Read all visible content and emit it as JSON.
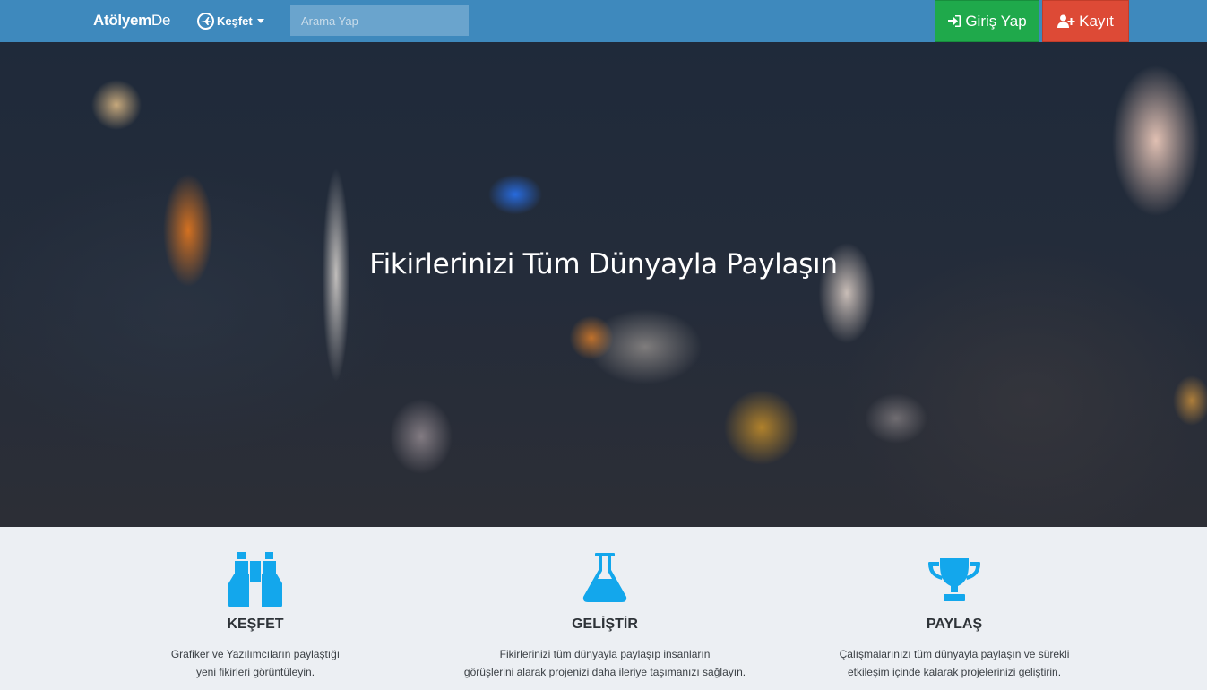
{
  "navbar": {
    "brand_bold": "Atölyem",
    "brand_light": "De",
    "explore_label": "Keşfet",
    "search_placeholder": "Arama Yap",
    "login_label": "Giriş Yap",
    "register_label": "Kayıt",
    "icons": {
      "explore": "plane-globe-icon",
      "login": "sign-in-icon",
      "register": "user-plus-icon"
    }
  },
  "hero": {
    "title": "Fikirlerinizi Tüm Dünyayla Paylaşın"
  },
  "features": [
    {
      "icon": "binoculars-icon",
      "title": "KEŞFET",
      "line1": "Grafiker ve Yazılımcıların paylaştığı",
      "line2": "yeni fikirleri görüntüleyin."
    },
    {
      "icon": "flask-icon",
      "title": "GELİŞTİR",
      "line1": "Fikirlerinizi tüm dünyayla paylaşıp insanların",
      "line2": "görüşlerini alarak projenizi daha ileriye taşımanızı sağlayın."
    },
    {
      "icon": "trophy-icon",
      "title": "PAYLAŞ",
      "line1": "Çalışmalarınızı tüm dünyayla paylaşın ve sürekli",
      "line2": "etkileşim içinde kalarak projelerinizi geliştirin."
    }
  ],
  "colors": {
    "navbar": "#3e89bd",
    "login": "#1fa94b",
    "register": "#dd4a36",
    "feature_icon": "#13a7ec",
    "features_bg": "#eceff3"
  }
}
